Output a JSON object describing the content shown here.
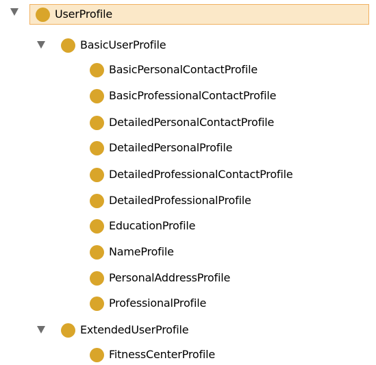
{
  "tree": {
    "root": {
      "label": "UserProfile"
    },
    "basic": {
      "label": "BasicUserProfile",
      "children": [
        "BasicPersonalContactProfile",
        "BasicProfessionalContactProfile",
        "DetailedPersonalContactProfile",
        "DetailedPersonalProfile",
        "DetailedProfessionalContactProfile",
        "DetailedProfessionalProfile",
        "EducationProfile",
        "NameProfile",
        "PersonalAddressProfile",
        "ProfessionalProfile"
      ]
    },
    "extended": {
      "label": "ExtendedUserProfile",
      "children": [
        "FitnessCenterProfile"
      ]
    }
  },
  "colors": {
    "class_dot": "#d9a52a",
    "selected_background": "#fbe8c8",
    "selected_border": "#f0b060",
    "toggle_arrow": "#6e6e6e"
  },
  "icons": {
    "expand_toggle": "triangle-down-icon",
    "class_node": "class-circle-icon"
  }
}
